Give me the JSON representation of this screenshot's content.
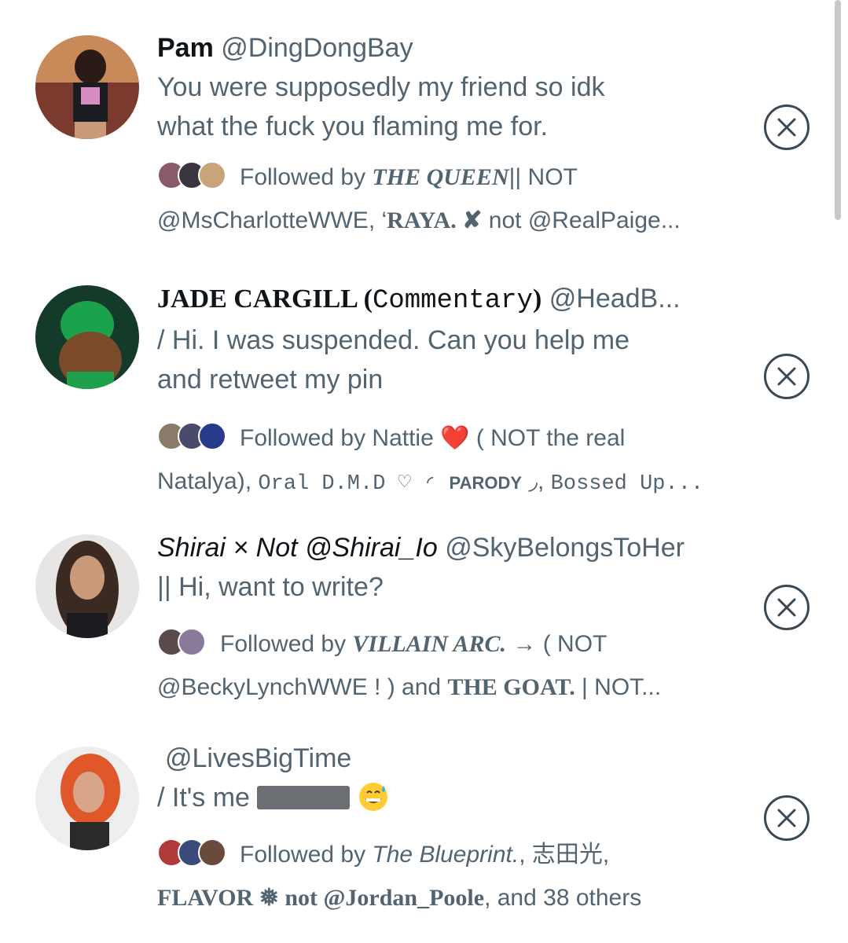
{
  "accounts": [
    {
      "name": "Pam",
      "handle": "@DingDongBay",
      "bio_line1": "You were supposedly my friend so idk",
      "bio_line2": "what the fuck you flaming me for.",
      "followed_prefix": "Followed by ",
      "followed_1a": "THE QUEEN",
      "followed_1b": "|| NOT",
      "followed_2a": "@MsCharlotteWWE, ‘",
      "followed_2b": "RAYA. ✘",
      "followed_2c": " not @RealPaige..."
    },
    {
      "name": "JADE CARGILL (",
      "name_mono": "Commentary",
      "name_end": ")",
      "handle": "@HeadB...",
      "bio_line1": "/ Hi. I was suspended. Can you help me",
      "bio_line2": "and retweet my pin",
      "followed_prefix": "Followed by Nattie ",
      "followed_emoji": "❤️",
      "followed_1b": " ( NOT the real",
      "followed_2a": "Natalya), ",
      "followed_2b": "Oral D.M.D ♡ ◜ ",
      "followed_2c": "PARODY",
      "followed_2d": " ◞, ",
      "followed_2e": "Bossed Up..."
    },
    {
      "name": "Shirai × Not @Shirai_Io",
      "handle": "@SkyBelongsToHer",
      "bio_line1": "|| Hi, want to write?",
      "followed_prefix": "Followed by ",
      "followed_1a": "VILLAIN ARC.",
      "followed_1b": " → ( NOT",
      "followed_2a": "@BeckyLynchWWE ! ) and ",
      "followed_2b": "THE GOAT.",
      "followed_2c": " | NOT..."
    },
    {
      "handle": "@LivesBigTime",
      "bio_line1": "/ It's me",
      "followed_prefix": "Followed by ",
      "followed_1a": "The Blueprint.",
      "followed_1b": ", 志田光,",
      "followed_2a": "FLAVOR ❅ not @Jordan_Poole",
      "followed_2b": ", and 38 others"
    }
  ],
  "colors": {
    "name": "#0f1419",
    "secondary": "#536471",
    "close_border": "#3b4954"
  },
  "icons": [
    "close-circle-icon",
    "avatar-image",
    "grinning-sweat-emoji"
  ]
}
